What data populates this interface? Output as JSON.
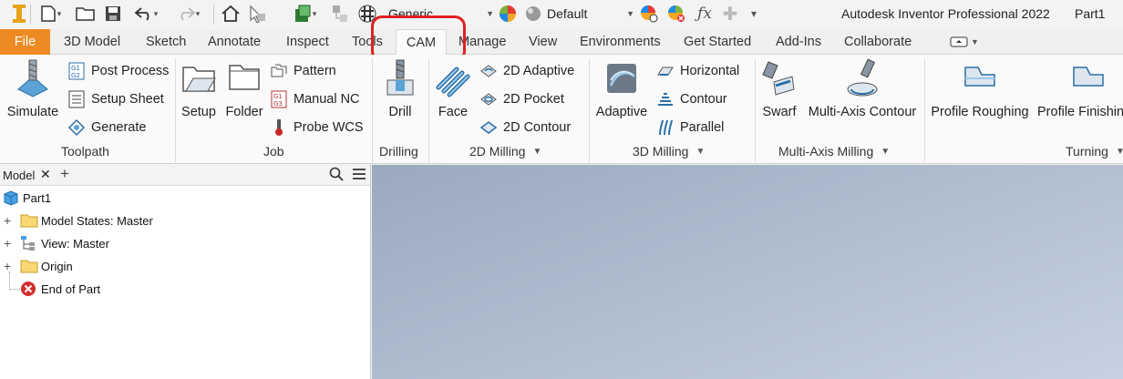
{
  "window": {
    "app_title": "Autodesk Inventor Professional 2022",
    "doc_title": "Part1"
  },
  "qat": {
    "material": "Generic",
    "appearance": "Default"
  },
  "tabs": [
    "File",
    "3D Model",
    "Sketch",
    "Annotate",
    "Inspect",
    "Tools",
    "CAM",
    "Manage",
    "View",
    "Environments",
    "Get Started",
    "Add-Ins",
    "Collaborate"
  ],
  "active_tab": "CAM",
  "ribbon": {
    "toolpath": {
      "label": "Toolpath",
      "simulate": "Simulate",
      "post_process": "Post Process",
      "setup_sheet": "Setup Sheet",
      "generate": "Generate"
    },
    "job": {
      "label": "Job",
      "setup": "Setup",
      "folder": "Folder",
      "pattern": "Pattern",
      "manual_nc": "Manual NC",
      "probe_wcs": "Probe WCS"
    },
    "drilling": {
      "label": "Drilling",
      "drill": "Drill"
    },
    "milling2d": {
      "label": "2D Milling",
      "face": "Face",
      "adaptive": "2D Adaptive",
      "pocket": "2D Pocket",
      "contour": "2D Contour"
    },
    "milling3d": {
      "label": "3D Milling",
      "adaptive": "Adaptive",
      "horizontal": "Horizontal",
      "contour": "Contour",
      "parallel": "Parallel"
    },
    "multiaxis": {
      "label": "Multi-Axis Milling",
      "swarf": "Swarf",
      "contour": "Multi-Axis Contour"
    },
    "turning": {
      "label": "Turning",
      "roughing": "Profile Roughing",
      "finishing": "Profile Finishing"
    }
  },
  "browser": {
    "tab_label": "Model",
    "items": [
      "Part1",
      "Model States: Master",
      "View: Master",
      "Origin",
      "End of Part"
    ]
  },
  "colors": {
    "file_tab": "#ee8a22",
    "highlight": "#e0211f",
    "viewport_top": "#9ba9bd",
    "viewport_bottom": "#c6d2e2"
  }
}
